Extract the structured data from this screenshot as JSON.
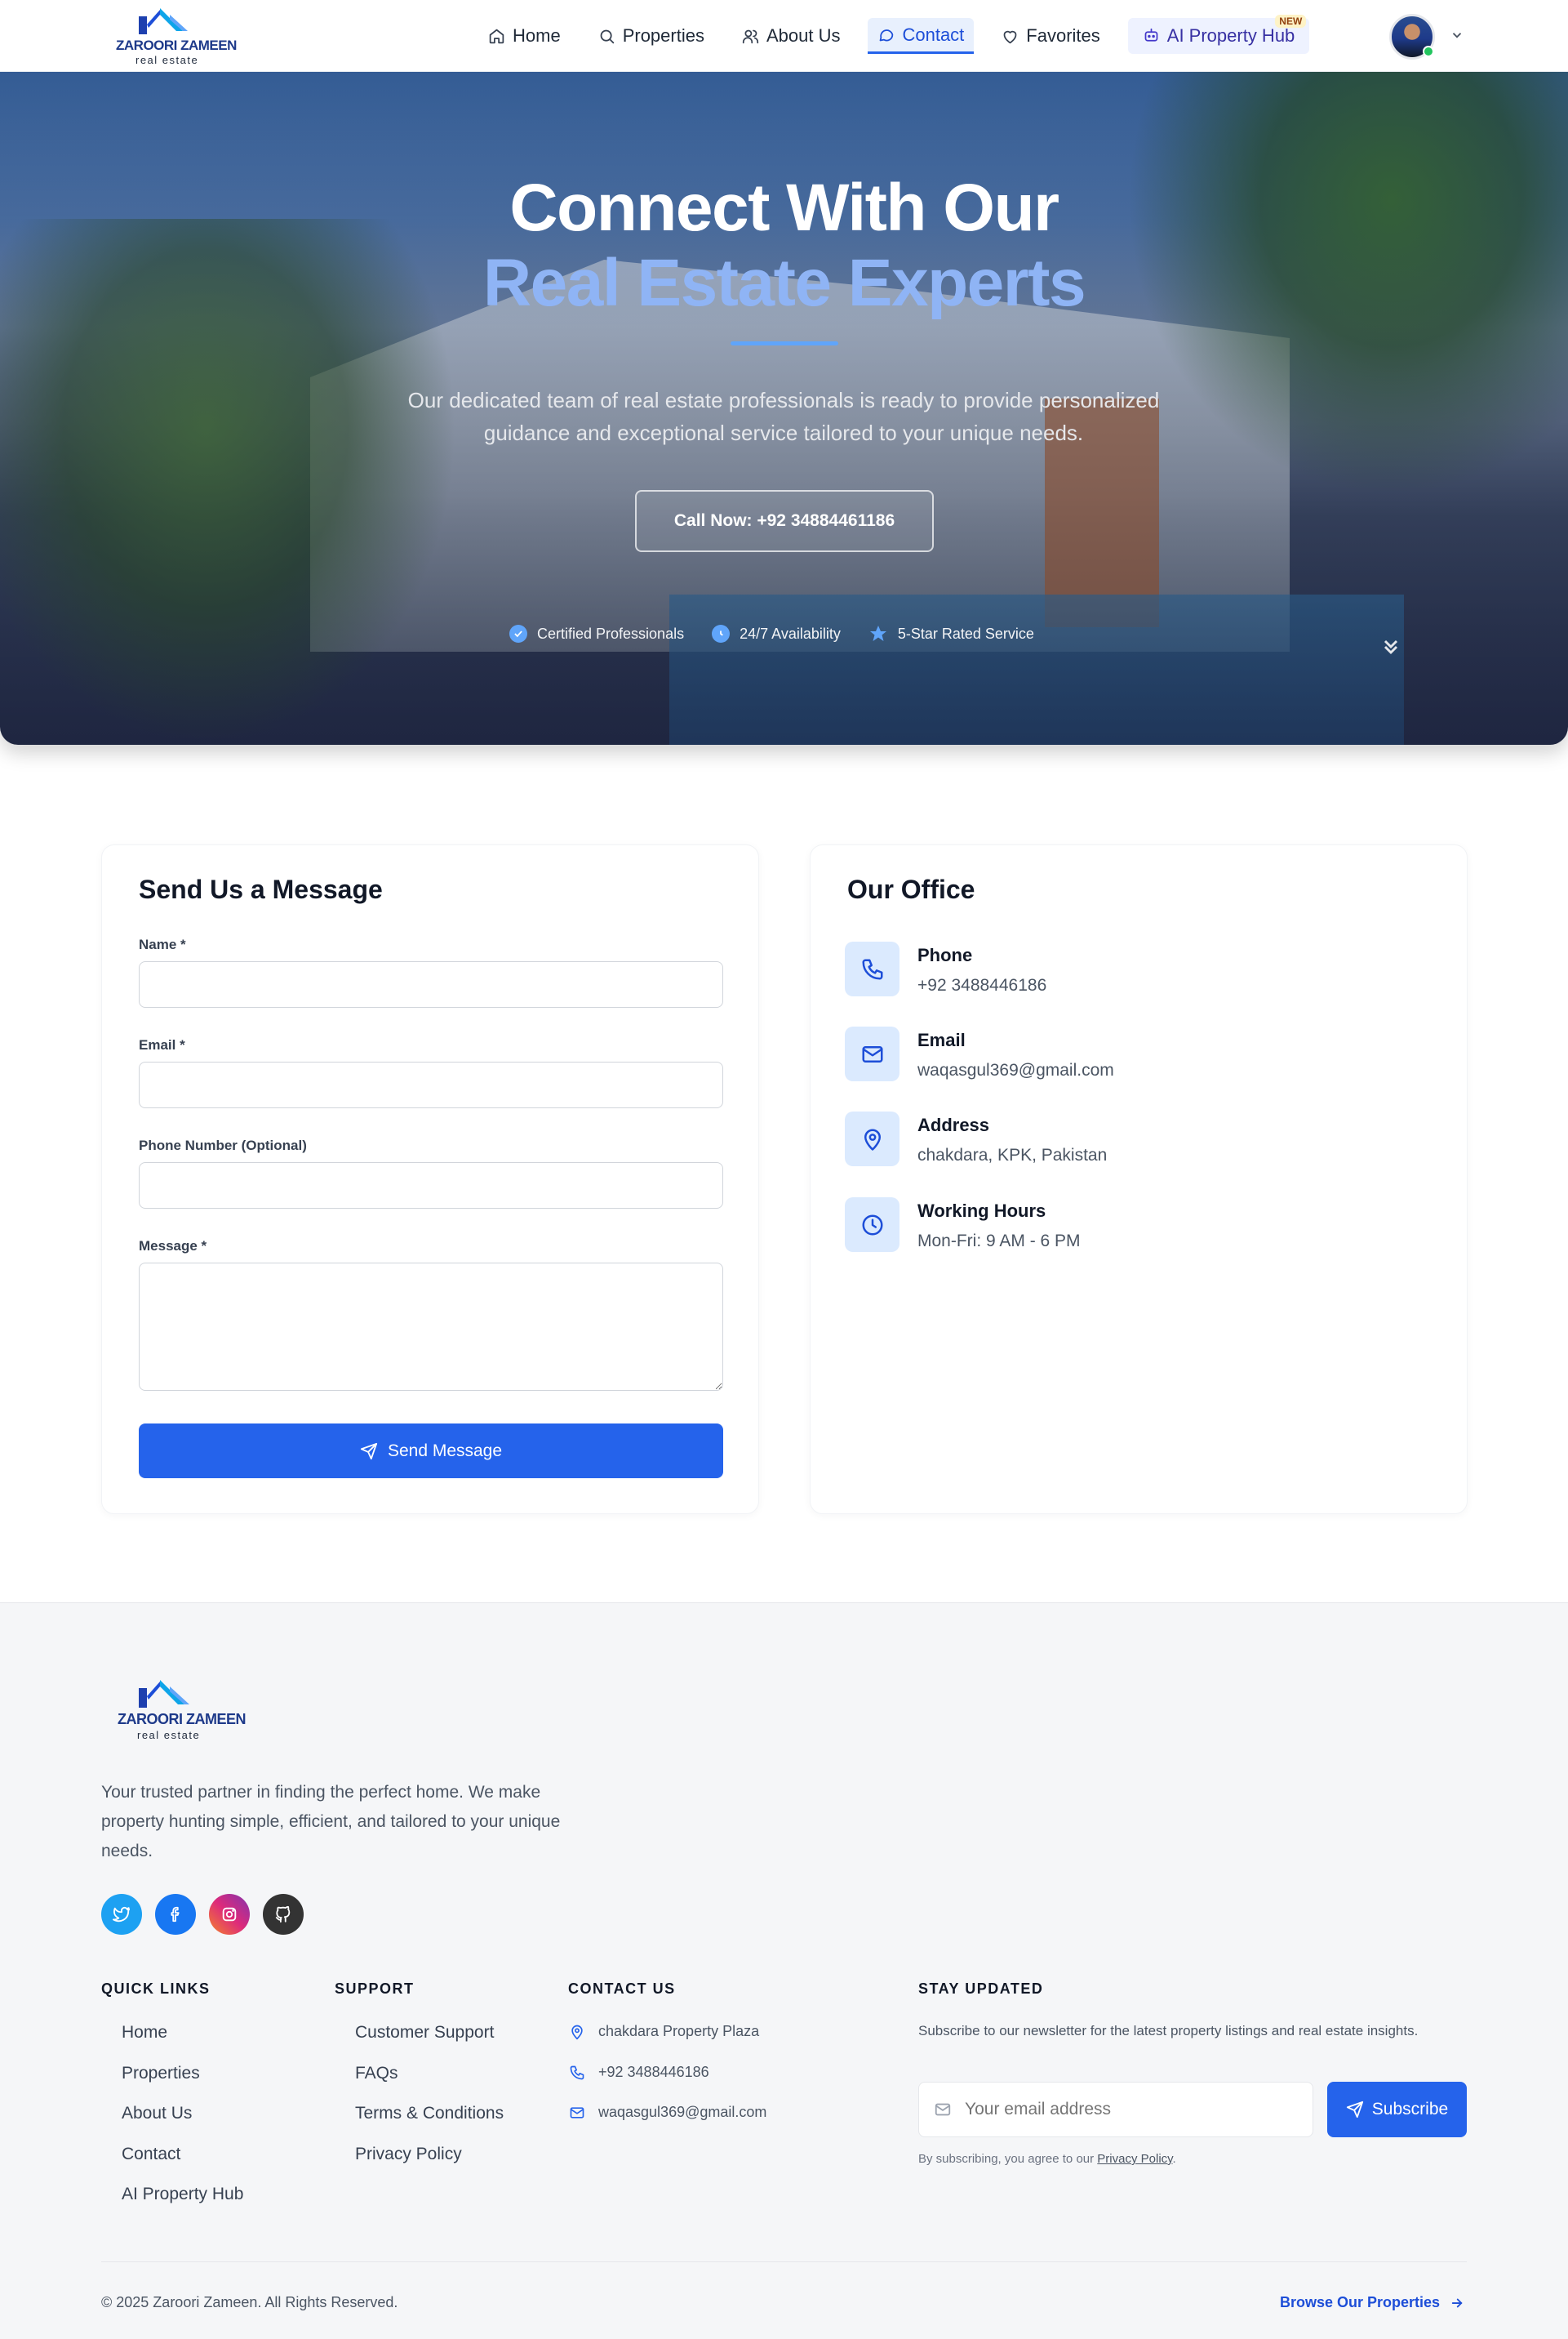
{
  "brand": {
    "name": "ZAROORI ZAMEEN",
    "tagline": "real estate"
  },
  "nav": {
    "items": [
      {
        "label": "Home",
        "icon": "home-icon"
      },
      {
        "label": "Properties",
        "icon": "search-icon"
      },
      {
        "label": "About Us",
        "icon": "users-icon"
      },
      {
        "label": "Contact",
        "icon": "message-icon",
        "active": true
      },
      {
        "label": "Favorites",
        "icon": "heart-icon"
      },
      {
        "label": "AI Property Hub",
        "icon": "bot-icon",
        "badge": "NEW"
      }
    ]
  },
  "hero": {
    "title_line1": "Connect With Our",
    "title_line2": "Real Estate Experts",
    "description": "Our dedicated team of real estate professionals is ready to provide personalized guidance and exceptional service tailored to your unique needs.",
    "call_button": "Call Now: +92 34884461186",
    "features": [
      {
        "label": "Certified Professionals",
        "icon": "check-circle-icon"
      },
      {
        "label": "24/7 Availability",
        "icon": "clock-icon"
      },
      {
        "label": "5-Star Rated Service",
        "icon": "star-icon"
      }
    ]
  },
  "form": {
    "title": "Send Us a Message",
    "name_label": "Name *",
    "email_label": "Email *",
    "phone_label": "Phone Number (Optional)",
    "message_label": "Message *",
    "name_value": "",
    "email_value": "",
    "phone_value": "",
    "message_value": "",
    "submit_label": "Send Message"
  },
  "office": {
    "title": "Our Office",
    "items": [
      {
        "title": "Phone",
        "value": "+92 3488446186",
        "icon": "phone-icon"
      },
      {
        "title": "Email",
        "value": "waqasgul369@gmail.com",
        "icon": "mail-icon"
      },
      {
        "title": "Address",
        "value": "chakdara, KPK, Pakistan",
        "icon": "map-pin-icon"
      },
      {
        "title": "Working Hours",
        "value": "Mon-Fri: 9 AM - 6 PM",
        "icon": "clock-icon"
      }
    ]
  },
  "footer": {
    "about": "Your trusted partner in finding the perfect home. We make property hunting simple, efficient, and tailored to your unique needs.",
    "socials": [
      {
        "name": "twitter",
        "color": "#1da1f2"
      },
      {
        "name": "facebook",
        "color": "#1877f2"
      },
      {
        "name": "instagram",
        "color": "#d62976"
      },
      {
        "name": "github",
        "color": "#333333"
      }
    ],
    "quick_links_title": "QUICK LINKS",
    "quick_links": [
      "Home",
      "Properties",
      "About Us",
      "Contact",
      "AI Property Hub"
    ],
    "support_title": "SUPPORT",
    "support_links": [
      "Customer Support",
      "FAQs",
      "Terms & Conditions",
      "Privacy Policy"
    ],
    "contact_title": "CONTACT US",
    "contact": [
      {
        "value": "chakdara Property Plaza",
        "icon": "map-pin-icon"
      },
      {
        "value": "+92 3488446186",
        "icon": "phone-icon"
      },
      {
        "value": "waqasgul369@gmail.com",
        "icon": "mail-icon"
      }
    ],
    "newsletter_title": "STAY UPDATED",
    "newsletter_desc": "Subscribe to our newsletter for the latest property listings and real estate insights.",
    "email_placeholder": "Your email address",
    "subscribe_label": "Subscribe",
    "agree_prefix": "By subscribing, you agree to our",
    "agree_link": "Privacy Policy",
    "agree_suffix": ".",
    "copyright": "© 2025 Zaroori Zameen. All Rights Reserved.",
    "browse_label": "Browse Our Properties"
  },
  "colors": {
    "primary": "#2563eb",
    "accent_light": "#8fb4f5",
    "footer_bg": "#f5f6f8"
  }
}
